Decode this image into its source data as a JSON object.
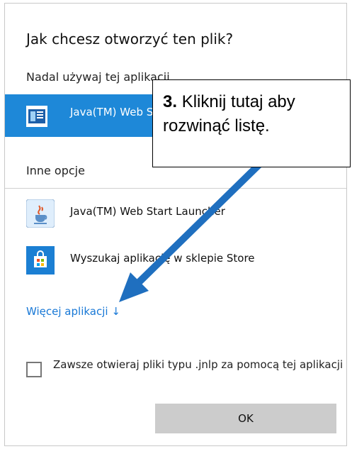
{
  "dialog": {
    "title": "Jak chcesz otworzyć ten plik?",
    "keep_using_label": "Nadal używaj tej aplikacji",
    "selected_app": {
      "name": "Java(TM) Web Start Launcher",
      "icon": "java-webstart-icon"
    },
    "other_options_label": "Inne opcje",
    "other_apps": [
      {
        "name": "Java(TM) Web Start Launcher",
        "icon": "java-cup-icon"
      },
      {
        "name": "Wyszukaj aplikację w sklepie Store",
        "icon": "store-icon"
      }
    ],
    "more_apps_link": "Więcej aplikacji",
    "more_apps_arrow": "↓",
    "always_checkbox_label": "Zawsze otwieraj pliki typu .jnlp za pomocą tej aplikacji",
    "always_checkbox_checked": false,
    "ok_label": "OK"
  },
  "annotation": {
    "step": "3.",
    "text": "Kliknij tutaj aby rozwinąć listę.",
    "arrow_color": "#1f6fbf"
  },
  "colors": {
    "selected_row": "#1e88d8",
    "link": "#1878d6",
    "ok_button": "#cccccc"
  }
}
